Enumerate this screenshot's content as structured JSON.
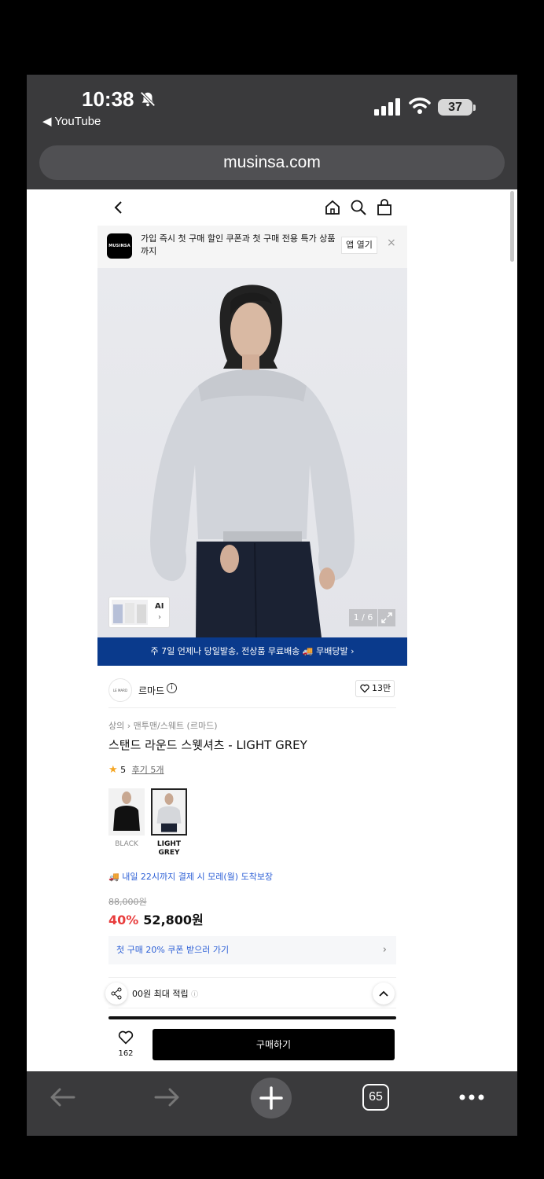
{
  "status": {
    "time": "10:38",
    "back_app": "◀ YouTube",
    "battery": "37"
  },
  "browser": {
    "url": "musinsa.com",
    "tab_count": "65"
  },
  "app_banner": {
    "logo": "MUSINSA",
    "message": "가입 즉시 첫 구매 할인 쿠폰과 첫 구매 전용 특가 상품까지",
    "open_label": "앱 열기",
    "close": "×"
  },
  "gallery": {
    "ai_label": "AI",
    "ai_chevron": "›",
    "counter": "1 / 6"
  },
  "delivery_banner": "주 7일 언제나 당일발송, 전상품 무료배송 🚚 무배당발 ›",
  "brand": {
    "logo_text": "LE MARD",
    "name": "르마드",
    "info": "i",
    "likes": "13만"
  },
  "product": {
    "breadcrumb": "상의 › 맨투맨/스웨트 (르마드)",
    "title": "스탠드 라운드 스웻셔츠 - LIGHT GREY",
    "rating_star": "★",
    "rating": "5",
    "reviews": "후기 5개",
    "colors": [
      {
        "label": "BLACK",
        "selected": false
      },
      {
        "label": "LIGHT GREY",
        "selected": true
      }
    ],
    "arrival": "🚚 내일 22시까지 결제 시 모레(월) 도착보장",
    "original_price": "88,000원",
    "discount": "40%",
    "price": "52,800원"
  },
  "coupon": {
    "label": "첫 구매 20% 쿠폰 받으러 가기",
    "chevron": "›"
  },
  "points": {
    "label": "00원 최대 적립",
    "info": "ⓘ"
  },
  "purchase": {
    "wish_count": "162",
    "buy_label": "구매하기"
  },
  "colors": {
    "status_bg": "#3a3a3c",
    "delivery_bg": "#0a3a8c",
    "discount_red": "#e83d3d",
    "link_blue": "#2c5fd6",
    "star": "#f5a623"
  }
}
